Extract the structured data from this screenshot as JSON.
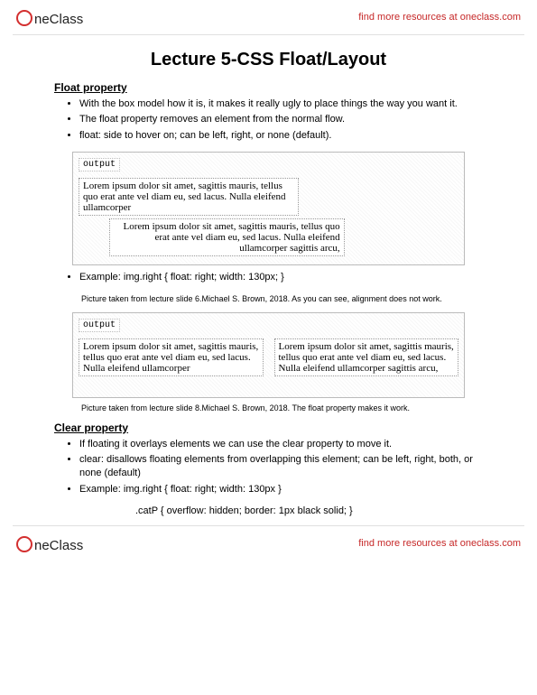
{
  "header": {
    "brand_rest": "neClass",
    "link_text": "find more resources at oneclass.com",
    "link_href": "#"
  },
  "title": "Lecture 5-CSS Float/Layout",
  "section1": {
    "heading": "Float property",
    "bullets": [
      "With the box model how it is, it makes it really ugly to place things the way you want it.",
      "The float property removes an element from the normal flow.",
      "float: side to hover on; can be left, right, or none (default)."
    ],
    "output_label": "output",
    "lorem1": "Lorem ipsum dolor sit amet, sagittis mauris, tellus quo erat ante vel diam eu, sed lacus. Nulla eleifend ullamcorper",
    "lorem2": "Lorem ipsum dolor sit amet, sagittis mauris, tellus quo erat ante vel diam eu, sed lacus. Nulla eleifend ullamcorper sagittis arcu,",
    "example_bullet": "Example: img.right { float: right; width: 130px; }",
    "caption1": "Picture taken from lecture slide 6.Michael S. Brown, 2018.  As you can see, alignment does not work.",
    "output_label2": "output",
    "lorem3": "Lorem ipsum dolor sit amet, sagittis mauris, tellus quo erat ante vel diam eu, sed lacus. Nulla eleifend ullamcorper",
    "lorem4": "Lorem ipsum dolor sit amet, sagittis mauris, tellus quo erat ante vel diam eu, sed lacus. Nulla eleifend ullamcorper sagittis arcu,",
    "caption2": "Picture taken from lecture slide 8.Michael S. Brown, 2018. The float property makes it work."
  },
  "section2": {
    "heading": "Clear property",
    "bullets": [
      "If floating it overlays elements we can use the clear property to move it.",
      "clear: disallows floating elements from overlapping this element; can be left, right, both, or none (default)",
      "Example: img.right { float: right; width: 130px }"
    ],
    "code_line": ".catP { overflow: hidden; border: 1px black solid; }"
  },
  "footer": {
    "brand_rest": "neClass",
    "link_text": "find more resources at oneclass.com"
  }
}
